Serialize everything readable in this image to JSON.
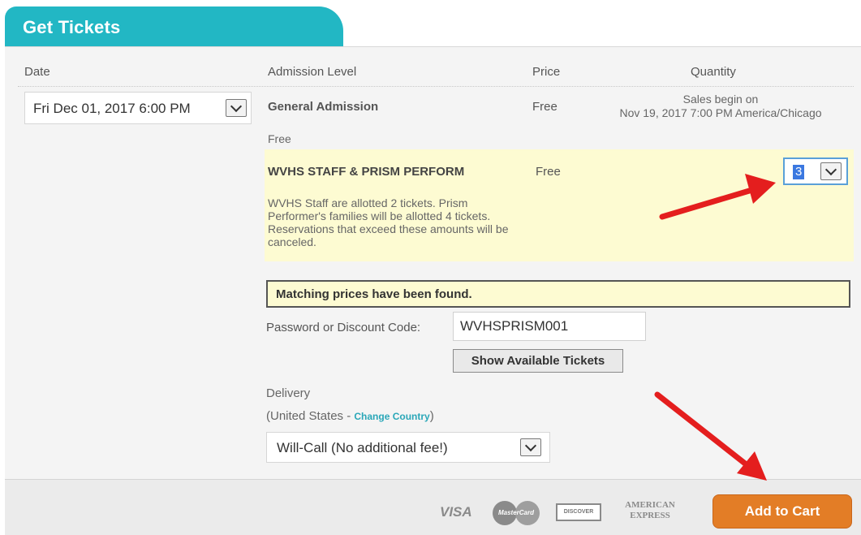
{
  "tab": {
    "title": "Get Tickets"
  },
  "headers": {
    "date": "Date",
    "admission": "Admission Level",
    "price": "Price",
    "quantity": "Quantity"
  },
  "date_select": {
    "value": "Fri Dec 01, 2017 6:00 PM"
  },
  "general": {
    "name": "General Admission",
    "price": "Free",
    "sales_line1": "Sales begin on",
    "sales_line2": "Nov 19, 2017 7:00 PM America/Chicago",
    "free_label": "Free"
  },
  "staff": {
    "name": "WVHS STAFF & PRISM PERFORM",
    "price": "Free",
    "desc_lines": [
      "WVHS Staff are allotted 2 tickets. Prism",
      "Performer's families will be allotted 4 tickets.",
      "Reservations that exceed these amounts will be",
      "canceled."
    ],
    "quantity": "3"
  },
  "match_message": "Matching prices have been found.",
  "discount": {
    "label": "Password or Discount Code:",
    "value": "WVHSPRISM001"
  },
  "show_button": "Show Available Tickets",
  "delivery": {
    "label": "Delivery",
    "country_prefix": "(United States - ",
    "change_link": "Change Country",
    "country_suffix": ")",
    "selected": "Will-Call (No additional fee!)"
  },
  "payment": {
    "visa": "VISA",
    "mastercard": "MasterCard",
    "discover": "DISCOVER",
    "amex_line1": "AMERICAN",
    "amex_line2": "EXPRESS"
  },
  "add_to_cart": "Add to Cart",
  "colors": {
    "accent": "#22b7c4",
    "cart": "#e37d26",
    "highlight": "#fdfbd2",
    "arrow": "#e41e1e"
  },
  "annotation_icons": [
    "red-arrow-icon",
    "red-arrow-icon"
  ]
}
